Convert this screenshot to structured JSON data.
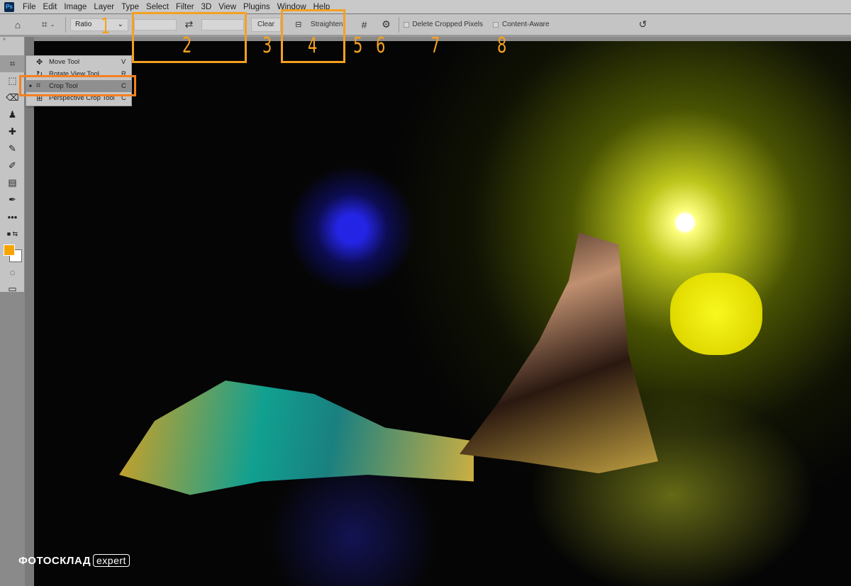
{
  "menubar": {
    "logo": "Ps",
    "items": [
      "File",
      "Edit",
      "Image",
      "Layer",
      "Type",
      "Select",
      "Filter",
      "3D",
      "View",
      "Plugins",
      "Window",
      "Help"
    ]
  },
  "options": {
    "ratio_select": "Ratio",
    "width_value": "",
    "height_value": "",
    "clear": "Clear",
    "straighten": "Straighten",
    "delete_cropped": "Delete Cropped Pixels",
    "delete_cropped_checked": false,
    "content_aware": "Content-Aware",
    "content_aware_checked": false
  },
  "flyout": {
    "items": [
      {
        "name": "Move Tool",
        "key": "V",
        "active": false
      },
      {
        "name": "Rotate View Tool",
        "key": "R",
        "active": false
      },
      {
        "name": "Crop Tool",
        "key": "C",
        "active": true
      },
      {
        "name": "Perspective Crop Tool",
        "key": "C",
        "active": false
      }
    ]
  },
  "colors": {
    "foreground": "#f7a400",
    "background": "#ffffff",
    "annotation": "#f5a020"
  },
  "annotations": [
    "1",
    "2",
    "3",
    "4",
    "5",
    "6",
    "7",
    "8"
  ],
  "watermark": {
    "brand": "ФОТОСКЛАД",
    "suffix": "expert"
  }
}
